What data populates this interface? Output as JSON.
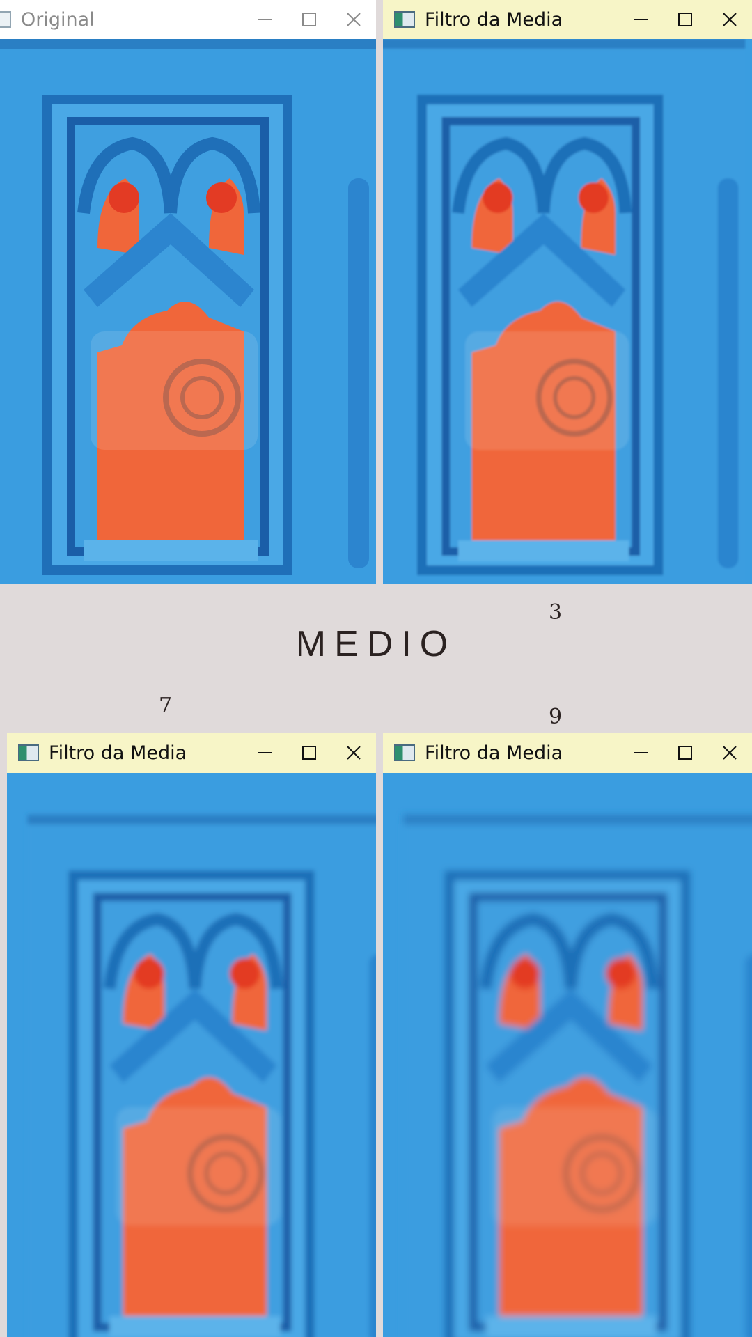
{
  "windows": [
    {
      "id": "original",
      "title": "Original",
      "state": "inactive"
    },
    {
      "id": "media3",
      "title": "Filtro da Media",
      "state": "active"
    },
    {
      "id": "media7",
      "title": "Filtro da Media",
      "state": "active"
    },
    {
      "id": "media9",
      "title": "Filtro da Media",
      "state": "active"
    }
  ],
  "caption": {
    "label": "MEDIO"
  },
  "kernel_sizes": {
    "k3": "3",
    "k7": "7",
    "k9": "9"
  },
  "colors": {
    "door_blue": "#3a9de0",
    "panel_orange": "#f0663a",
    "titlebar_active": "#f7f5c7",
    "background": "#e0dada"
  }
}
